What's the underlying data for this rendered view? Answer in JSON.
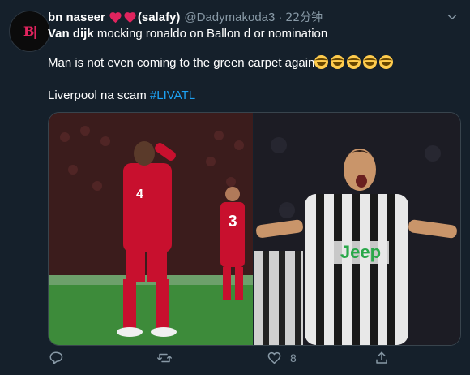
{
  "tweet": {
    "display_name": "bn naseer",
    "display_name_suffix": "(salafy)",
    "handle": "@Dadymakoda3",
    "separator": "·",
    "time": "22分钟",
    "line1_bold": "Van dijk",
    "line1_rest": " mocking ronaldo on Ballon d or nomination",
    "line2": "Man is not even coming to the green carpet again",
    "line2_emoji_count": 5,
    "line3_text": "Liverpool na scam ",
    "line3_hashtag": "#LIVATL",
    "media": {
      "left_photo": "footballer-hands-on-head-photo",
      "right_photo": "footballer-celebrating-photo",
      "left_number": "4",
      "left_bg_number": "3",
      "right_sponsor": "Jeep"
    },
    "actions": {
      "like_count": "8"
    }
  },
  "colors": {
    "background": "#15202b",
    "text": "#ffffff",
    "muted": "#8899a6",
    "link": "#1da1f2",
    "heart": "#e0245e",
    "border": "#38444d"
  }
}
